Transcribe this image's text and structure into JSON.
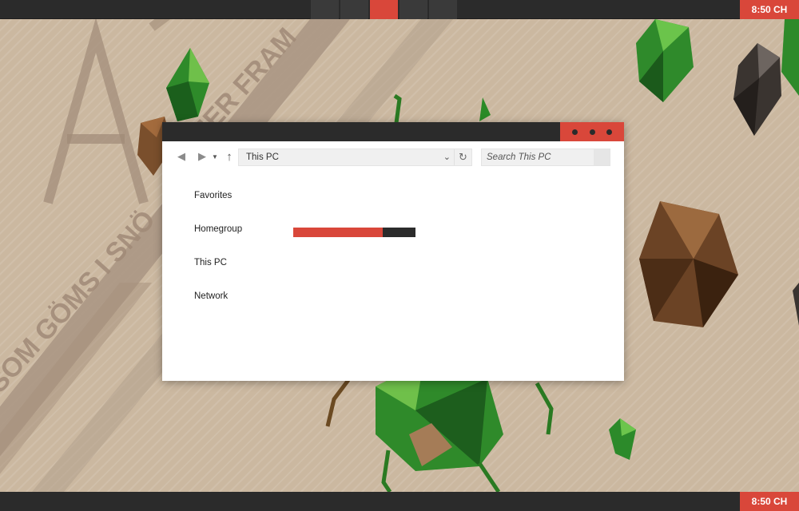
{
  "taskbar": {
    "clock_top": "8:50 CH",
    "clock_bottom": "8:50 CH"
  },
  "wallpaper": {
    "text_top": "MER FRAM",
    "text_bottom": "SOM GÖMS I SNÖ"
  },
  "window": {
    "address_text": "This PC",
    "search_placeholder": "Search This PC",
    "nav_items": [
      "Favorites",
      "Homegroup",
      "This PC",
      "Network"
    ],
    "progress_fraction": 0.73,
    "icons": {
      "back": "back-arrow-icon",
      "forward": "forward-arrow-icon",
      "history": "chevron-down-icon",
      "up": "up-arrow-icon",
      "refresh": "refresh-icon",
      "search": "search-icon"
    }
  },
  "colors": {
    "accent": "#d9473a",
    "dark": "#2b2b2b",
    "wallpaper": "#cbb8a0"
  }
}
